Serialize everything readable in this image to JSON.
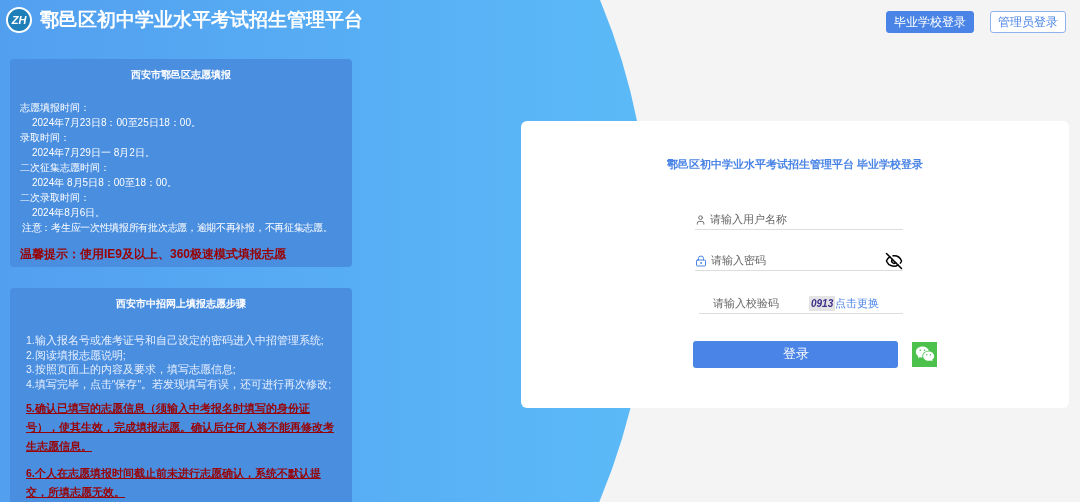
{
  "header": {
    "logo_text": "ZH",
    "title": "鄠邑区初中学业水平考试招生管理平台"
  },
  "nav_buttons": [
    {
      "label": "毕业学校登录",
      "selected": true
    },
    {
      "label": "管理员登录",
      "selected": false
    }
  ],
  "info_panel": {
    "title": "西安市鄠邑区志愿填报",
    "schedule": [
      {
        "label": "志愿填报时间：",
        "children": [
          "2024年7月23日8：00至25日18：00。"
        ]
      },
      {
        "label": "录取时间：",
        "children": [
          "2024年7月29日一 8月2日。"
        ]
      },
      {
        "label": "二次征集志愿时间：",
        "children": [
          "2024年 8月5日8：00至18：00。"
        ]
      },
      {
        "label": "二次录取时间：",
        "children": [
          "2024年8月6日。"
        ]
      }
    ],
    "note": "注意：考生应一次性填报所有批次志愿，逾期不再补报，不再征集志愿。",
    "tip": "温馨提示：使用IE9及以上、360极速模式填报志愿"
  },
  "steps_panel": {
    "title": "西安市中招网上填报志愿步骤",
    "steps": [
      {
        "kind": "normal",
        "text": "1.输入报名号或准考证号和自己设定的密码进入中招管理系统;"
      },
      {
        "kind": "normal",
        "text": "2.阅读填报志愿说明;"
      },
      {
        "kind": "normal",
        "text": "3.按照页面上的内容及要求，填写志愿信息;"
      },
      {
        "kind": "normal",
        "text": "4.填写完毕，点击\"保存\"。若发现填写有误，还可进行再次修改;"
      },
      {
        "kind": "warning",
        "text": "5.确认已填写的志愿信息（须输入中考报名时填写的身份证号），使其生效，完成填报志愿。确认后任何人将不能再修改考生志愿信息。"
      },
      {
        "kind": "warning",
        "text": "6.个人在志愿填报时间截止前未进行志愿确认，系统不默认提交，所填志愿无效。"
      }
    ]
  },
  "login": {
    "title": "鄠邑区初中学业水平考试招生管理平台 毕业学校登录",
    "username": {
      "placeholder": "请输入用户名称"
    },
    "password": {
      "placeholder": "请输入密码"
    },
    "captcha": {
      "placeholder": "请输入校验码",
      "code": "0913",
      "refresh": "点击更换"
    },
    "submit": "登录"
  }
}
